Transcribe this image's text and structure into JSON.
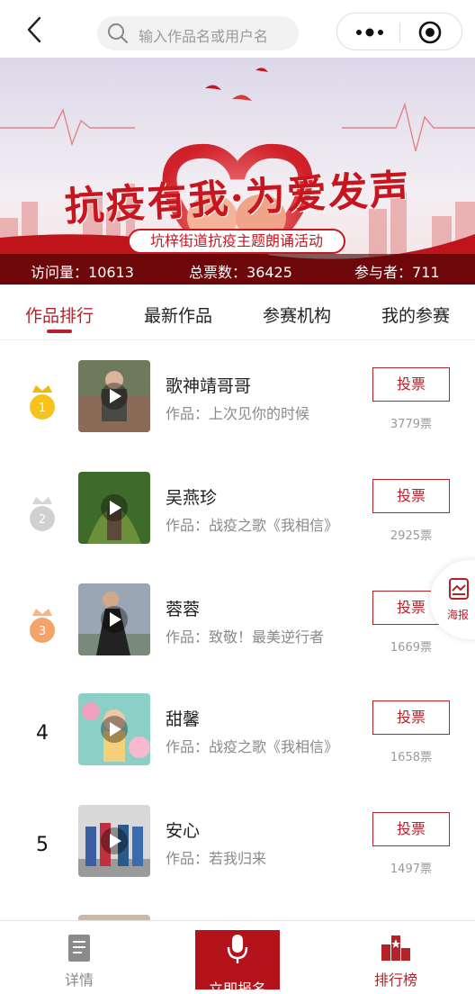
{
  "search": {
    "placeholder": "输入作品名或用户名"
  },
  "banner": {
    "title": "抗疫有我·为爱发声",
    "subtitle": "坑梓街道抗疫主题朗诵活动",
    "stats": {
      "visits_label": "访问量：",
      "visits": "10613",
      "votes_label": "总票数：",
      "votes": "36425",
      "participants_label": "参与者：",
      "participants": "711"
    }
  },
  "tabs": [
    {
      "label": "作品排行",
      "active": true
    },
    {
      "label": "最新作品"
    },
    {
      "label": "参赛机构"
    },
    {
      "label": "我的参赛"
    }
  ],
  "entries": [
    {
      "rank": "1",
      "name": "歌神靖哥哥",
      "work": "作品：上次见你的时候",
      "vote_label": "投票",
      "votes": "3779票",
      "medal": "gold"
    },
    {
      "rank": "2",
      "name": "吴燕珍",
      "work": "作品：战疫之歌《我相信》",
      "vote_label": "投票",
      "votes": "2925票",
      "medal": "silver"
    },
    {
      "rank": "3",
      "name": "蓉蓉",
      "work": "作品：致敬！最美逆行者",
      "vote_label": "投票",
      "votes": "1669票",
      "medal": "bronze"
    },
    {
      "rank": "4",
      "name": "甜馨",
      "work": "作品：战疫之歌《我相信》",
      "vote_label": "投票",
      "votes": "1658票"
    },
    {
      "rank": "5",
      "name": "安心",
      "work": "作品：若我归来",
      "vote_label": "投票",
      "votes": "1497票"
    }
  ],
  "poster": {
    "label": "海报",
    "icon": "poster-icon"
  },
  "bottom_bar": {
    "detail_label": "详情",
    "signup_label": "立即报名",
    "ranking_label": "排行榜"
  },
  "colors": {
    "accent": "#b5222a",
    "gold": "#f2b705",
    "silver": "#cfcfcf",
    "bronze": "#f4a36a"
  }
}
